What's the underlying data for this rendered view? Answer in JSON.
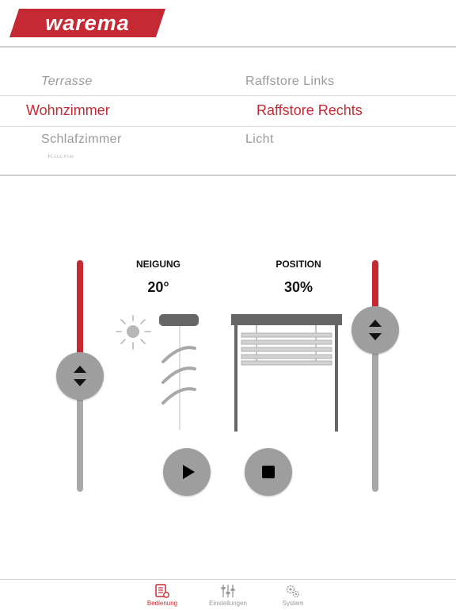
{
  "header": {
    "logo_text": "warema"
  },
  "picker": {
    "rooms": {
      "above": "Terrasse",
      "selected": "Wohnzimmer",
      "below": "Schlafzimmer",
      "faint": "Küche"
    },
    "devices": {
      "above": "Raffstore Links",
      "selected": "Raffstore Rechts",
      "below": "Licht"
    }
  },
  "controls": {
    "tilt": {
      "label": "NEIGUNG",
      "value": "20°",
      "fill_fraction": 0.5
    },
    "position": {
      "label": "POSITION",
      "value": "30%",
      "fill_fraction": 0.3
    }
  },
  "tabs": [
    {
      "label": "Bedienung",
      "icon": "remote-control-icon",
      "active": true
    },
    {
      "label": "Einstellungen",
      "icon": "sliders-icon",
      "active": false
    },
    {
      "label": "System",
      "icon": "gears-icon",
      "active": false
    }
  ],
  "colors": {
    "brand_red": "#c52a34",
    "control_gray": "#9e9e9e",
    "track_gray": "#a8a8a8"
  }
}
